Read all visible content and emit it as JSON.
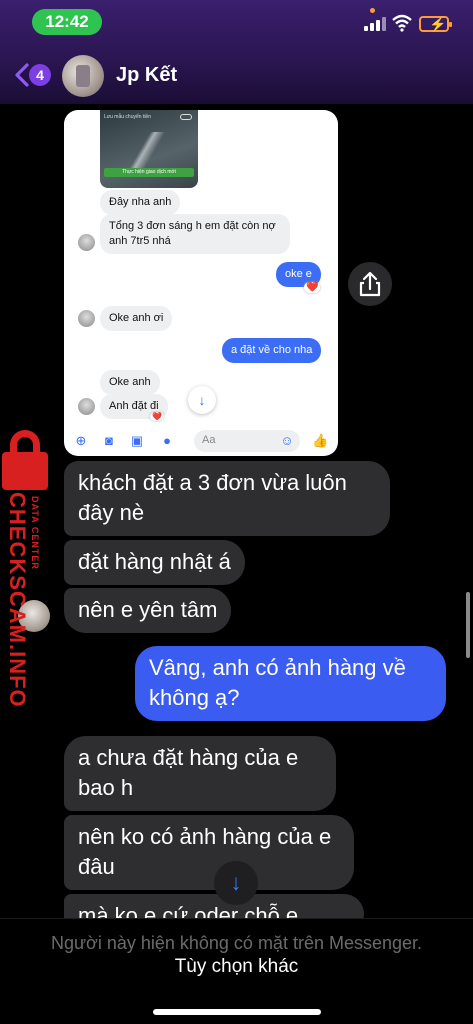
{
  "status_bar": {
    "time": "12:42"
  },
  "header": {
    "back_count": "4",
    "contact_name": "Jp Kết"
  },
  "screenshot": {
    "image_caption": "Lưu mẫu chuyển tiền",
    "image_button": "Thực hiện giao dịch mới",
    "messages": [
      {
        "side": "in",
        "text": "Đây nha anh"
      },
      {
        "side": "in",
        "text": "Tổng 3 đơn sáng h em đặt còn nợ anh 7tr5 nhá"
      },
      {
        "side": "out",
        "text": "oke e"
      },
      {
        "side": "in",
        "text": "Oke anh ơi"
      },
      {
        "side": "out",
        "text": "a đặt về cho nha"
      },
      {
        "side": "in",
        "text": "Oke anh"
      },
      {
        "side": "in",
        "text": "Anh đặt đi"
      }
    ],
    "input_placeholder": "Aa"
  },
  "messages": [
    {
      "side": "in",
      "text": "khách đặt a 3 đơn vừa luôn đây nè"
    },
    {
      "side": "in",
      "text": "đặt hàng nhật á"
    },
    {
      "side": "in",
      "text": "nên e yên tâm"
    },
    {
      "side": "out",
      "text": "Vâng, anh có ảnh hàng về không ạ?"
    },
    {
      "side": "in",
      "text": "a chưa đặt hàng của e bao h"
    },
    {
      "side": "in",
      "text": "nên ko có ảnh hàng của e đâu"
    },
    {
      "side": "in",
      "text": "mà ko e cứ oder chỗ e"
    }
  ],
  "footer": {
    "note": "Người này hiện không có mặt trên Messenger.",
    "link": "Tùy chọn khác"
  },
  "watermark": {
    "brand": "CHECKSCAM.INFO",
    "sub": "DATA CENTER"
  },
  "colors": {
    "accent": "#3b5cf0",
    "header": "#2a1550",
    "status_green": "#2fc44f"
  }
}
